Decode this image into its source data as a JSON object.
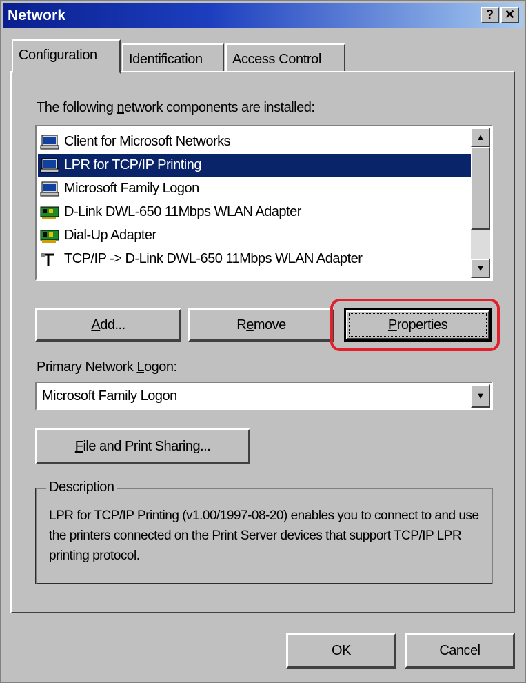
{
  "window": {
    "title": "Network",
    "help_label": "?",
    "close_label": "✕"
  },
  "tabs": [
    {
      "label": "Configuration"
    },
    {
      "label": "Identification"
    },
    {
      "label": "Access Control"
    }
  ],
  "components": {
    "label_pre": "The following ",
    "label_key": "n",
    "label_post": "etwork components are installed:",
    "items": [
      {
        "label": "Client for Microsoft Networks",
        "icon": "client-icon"
      },
      {
        "label": "LPR for TCP/IP Printing",
        "icon": "client-icon"
      },
      {
        "label": "Microsoft Family Logon",
        "icon": "client-icon"
      },
      {
        "label": "D-Link DWL-650 11Mbps WLAN Adapter",
        "icon": "network-adapter-icon"
      },
      {
        "label": "Dial-Up Adapter",
        "icon": "network-adapter-icon"
      },
      {
        "label": "TCP/IP -> D-Link DWL-650 11Mbps WLAN Adapter",
        "icon": "protocol-icon"
      }
    ],
    "selected_index": 1
  },
  "buttons": {
    "add_key": "A",
    "add_rest": "dd...",
    "remove_pre": "R",
    "remove_key": "e",
    "remove_post": "move",
    "properties_key": "P",
    "properties_rest": "roperties",
    "share_key": "F",
    "share_rest": "ile and Print Sharing...",
    "ok": "OK",
    "cancel": "Cancel"
  },
  "primary_logon": {
    "label_pre": "Primary Network ",
    "label_key": "L",
    "label_post": "ogon:",
    "value": "Microsoft Family Logon"
  },
  "description": {
    "title": "Description",
    "text": "LPR for TCP/IP Printing (v1.00/1997-08-20) enables you to connect to and use the printers connected on the Print Server devices that support TCP/IP LPR printing protocol."
  },
  "colors": {
    "selection": "#0a246a",
    "highlight": "#e0202a",
    "face": "#c0c0c0"
  }
}
